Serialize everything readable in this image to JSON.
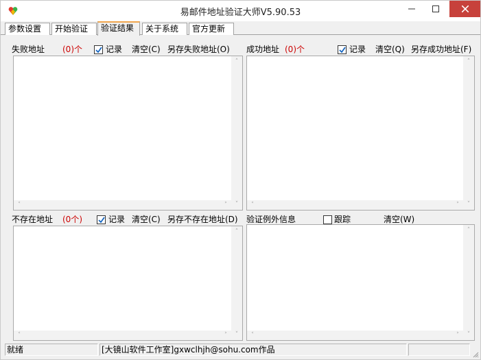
{
  "window": {
    "title": "易邮件地址验证大师V5.90.53",
    "icon": "heart-logo-icon",
    "controls": [
      "minimize-icon",
      "maximize-icon",
      "close-icon"
    ]
  },
  "tabs": [
    {
      "label": "参数设置",
      "active": false
    },
    {
      "label": "开始验证",
      "active": false
    },
    {
      "label": "验证结果",
      "active": true
    },
    {
      "label": "关于系统",
      "active": false
    },
    {
      "label": "官方更新",
      "active": false
    }
  ],
  "failed": {
    "label": "失败地址",
    "count": "(0)个",
    "record_label": "记录",
    "record_checked": true,
    "clear_label": "清空(C)",
    "save_label": "另存失败地址(O)"
  },
  "success": {
    "label": "成功地址",
    "count": "(0)个",
    "record_label": "记录",
    "record_checked": true,
    "clear_label": "清空(Q)",
    "save_label": "另存成功地址(F)"
  },
  "nonexistent": {
    "label": "不存在地址",
    "count": "(0个)",
    "record_label": "记录",
    "record_checked": true,
    "clear_label": "清空(C)",
    "save_label": "另存不存在地址(D)"
  },
  "exceptions": {
    "label": "验证例外信息",
    "trace_label": "跟踪",
    "trace_checked": false,
    "clear_label": "清空(W)"
  },
  "status": {
    "state": "就绪",
    "credit": "[大镜山软件工作室]gxwclhjh@sohu.com作品",
    "extra": ""
  },
  "colors": {
    "count_red": "#cc0000",
    "close_button": "#c7413b",
    "active_tab_accent": "#f0a54c"
  }
}
